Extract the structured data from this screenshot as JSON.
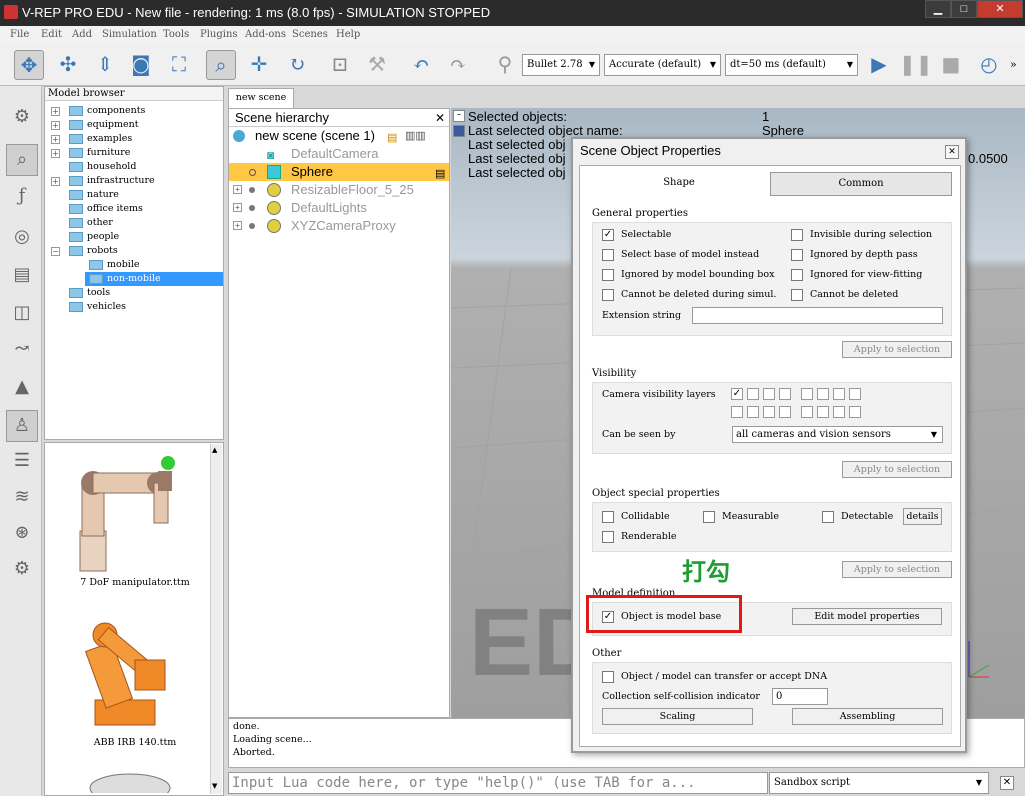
{
  "window": {
    "title": "V-REP PRO EDU - New file - rendering: 1 ms (8.0 fps) - SIMULATION STOPPED",
    "minimize": "▁",
    "maximize": "□",
    "close": "✕"
  },
  "menu": [
    "File",
    "Edit",
    "Add",
    "Simulation",
    "Tools",
    "Plugins",
    "Add-ons",
    "Scenes",
    "Help"
  ],
  "toolbar": {
    "engine": "Bullet 2.78",
    "accuracy": "Accurate (default)",
    "dt": "dt=50 ms (default)"
  },
  "model_browser": {
    "header": "Model browser",
    "items": [
      "components",
      "equipment",
      "examples",
      "furniture",
      "household",
      "infrastructure",
      "nature",
      "office items",
      "other",
      "people",
      "robots",
      "mobile",
      "non-mobile",
      "tools",
      "vehicles"
    ],
    "thumbs": [
      "7 DoF manipulator.ttm",
      "ABB IRB 140.ttm"
    ]
  },
  "scene_tab": "new scene",
  "hierarchy": {
    "title": "Scene hierarchy",
    "root": "new scene (scene 1)",
    "items": [
      "DefaultCamera",
      "Sphere",
      "ResizableFloor_5_25",
      "DefaultLights",
      "XYZCameraProxy"
    ]
  },
  "viewport": {
    "sel_label": "Selected objects:",
    "sel_value": "1",
    "last_name_label": "Last selected object name:",
    "last_name_value": "Sphere",
    "l3": "Last selected obj",
    "l4": "Last selected obj",
    "l5": "Last selected obj",
    "num": "0.0500",
    "brand": "ED"
  },
  "console": [
    "done.",
    "Loading scene...",
    "Aborted."
  ],
  "lua_placeholder": "Input Lua code here, or type \"help()\" (use TAB for a...",
  "sandbox": "Sandbox script",
  "dialog": {
    "title": "Scene Object Properties",
    "tabs": [
      "Shape",
      "Common"
    ],
    "general": {
      "title": "General properties",
      "selectable": "Selectable",
      "invisible": "Invisible during selection",
      "select_base": "Select base of model instead",
      "ignored_depth": "Ignored by depth pass",
      "ignored_bbox": "Ignored by model bounding  box",
      "ignored_view": "Ignored for view-fitting",
      "cannot_del_sim": "Cannot be deleted during simul.",
      "cannot_del": "Cannot be deleted",
      "ext_label": "Extension string",
      "apply": "Apply to selection"
    },
    "visibility": {
      "title": "Visibility",
      "layers_label": "Camera visibility layers",
      "seen_label": "Can be seen by",
      "seen_value": "all cameras and vision sensors",
      "apply": "Apply to selection"
    },
    "special": {
      "title": "Object special properties",
      "collidable": "Collidable",
      "measurable": "Measurable",
      "detectable": "Detectable",
      "details": "details",
      "renderable": "Renderable",
      "apply": "Apply to selection"
    },
    "model": {
      "title": "Model definition",
      "is_base": "Object is model base",
      "edit": "Edit model properties"
    },
    "other": {
      "title": "Other",
      "dna": "Object / model can transfer or accept DNA",
      "collision_label": "Collection self-collision indicator",
      "collision_value": "0",
      "scaling": "Scaling",
      "assembling": "Assembling"
    }
  },
  "annotation": "打勾",
  "colors": {
    "highlight": "#ffc744",
    "selected_tree": "#3399ff",
    "annotation": "#1e9e32",
    "redbox": "#e0191b"
  }
}
